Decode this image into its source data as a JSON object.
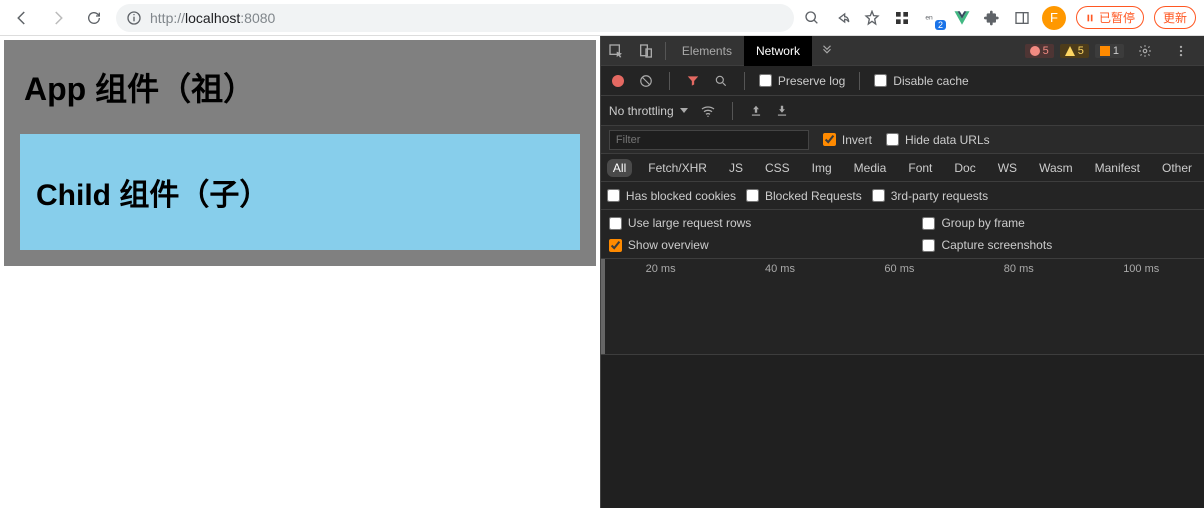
{
  "browser": {
    "url_scheme": "http://",
    "url_host": "localhost",
    "url_port": ":8080",
    "profile_letter": "F",
    "paused_label": "已暂停",
    "update_label": "更新",
    "lang_badge": "2"
  },
  "page": {
    "app_title": "App 组件（祖）",
    "child_title": "Child 组件（子）"
  },
  "devtools": {
    "tabs": {
      "elements": "Elements",
      "network": "Network"
    },
    "badges": {
      "errors": "5",
      "warnings": "5",
      "info": "1"
    },
    "toolbar": {
      "preserve_log": "Preserve log",
      "disable_cache": "Disable cache",
      "no_throttling": "No throttling"
    },
    "filter": {
      "placeholder": "Filter",
      "invert": "Invert",
      "hide_data_urls": "Hide data URLs"
    },
    "types": [
      "All",
      "Fetch/XHR",
      "JS",
      "CSS",
      "Img",
      "Media",
      "Font",
      "Doc",
      "WS",
      "Wasm",
      "Manifest",
      "Other"
    ],
    "checks": {
      "blocked_cookies": "Has blocked cookies",
      "blocked_requests": "Blocked Requests",
      "third_party": "3rd-party requests",
      "large_rows": "Use large request rows",
      "group_frame": "Group by frame",
      "show_overview": "Show overview",
      "capture_screenshots": "Capture screenshots"
    },
    "timeline_ticks": [
      "20 ms",
      "40 ms",
      "60 ms",
      "80 ms",
      "100 ms"
    ]
  }
}
